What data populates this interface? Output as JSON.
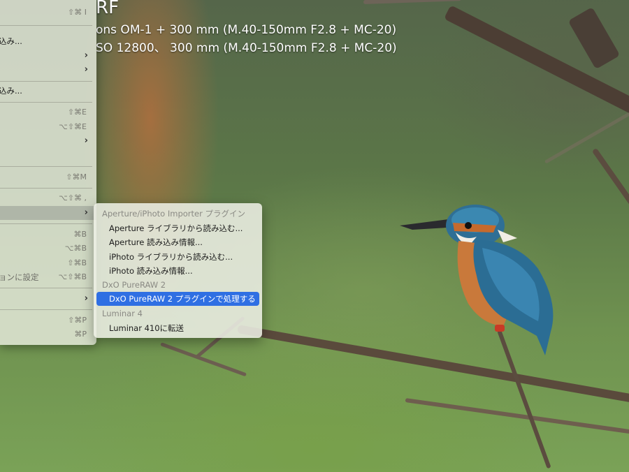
{
  "photo": {
    "description": "",
    "title_fragment": "RF",
    "exif_line1": "ons OM-1 + 300 mm (M.40-150mm F2.8 + MC-20)",
    "exif_line2": "SO 12800、 300 mm (M.40-150mm F2.8 + MC-20)"
  },
  "main_menu": {
    "items": [
      {
        "label": "",
        "shortcut": "⇧⌘ I"
      },
      {
        "label": "込み...",
        "shortcut": ""
      },
      {
        "label": "",
        "arrow": "›"
      },
      {
        "label": "",
        "arrow": "›"
      },
      {
        "label": "込み...",
        "shortcut": ""
      },
      {
        "label": "",
        "shortcut": "⇧⌘E"
      },
      {
        "label": "",
        "shortcut": "⌥⇧⌘E"
      },
      {
        "label": "",
        "arrow": "›"
      },
      {
        "label": "",
        "shortcut": "⇧⌘M"
      },
      {
        "label": "",
        "shortcut": "⌥⇧⌘ ,"
      },
      {
        "label": "",
        "arrow": "›"
      },
      {
        "label": "",
        "shortcut": "⌘B"
      },
      {
        "label": "",
        "shortcut": "⌥⌘B"
      },
      {
        "label": "",
        "shortcut": "⇧⌘B"
      },
      {
        "label": "ョンに設定",
        "shortcut": "⌥⇧⌘B"
      },
      {
        "label": "",
        "arrow": "›"
      },
      {
        "label": "",
        "shortcut": "⇧⌘P"
      },
      {
        "label": "",
        "shortcut": "⌘P"
      }
    ]
  },
  "submenu": {
    "section1_header": "Aperture/iPhoto Importer プラグイン",
    "section1_items": [
      "Aperture ライブラリから読み込む...",
      "Aperture 読み込み情報...",
      "iPhoto ライブラリから読み込む...",
      "iPhoto 読み込み情報..."
    ],
    "section2_header": "DxO PureRAW 2",
    "section2_selected": "DxO PureRAW 2 プラグインで処理する",
    "section3_header": "Luminar 4",
    "section3_items": [
      "Luminar 410に転送"
    ]
  }
}
